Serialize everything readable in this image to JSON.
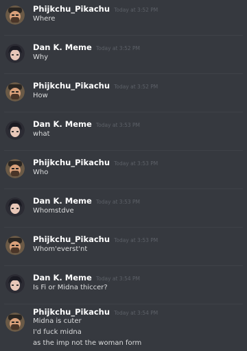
{
  "messages": [
    {
      "author": "Phijkchu_Pikachu",
      "timestamp": "Today at 3:52 PM",
      "lines": [
        "Where"
      ]
    },
    {
      "author": "Dan K. Meme",
      "timestamp": "Today at 3:52 PM",
      "lines": [
        "Why"
      ]
    },
    {
      "author": "Phijkchu_Pikachu",
      "timestamp": "Today at 3:52 PM",
      "lines": [
        "How"
      ]
    },
    {
      "author": "Dan K. Meme",
      "timestamp": "Today at 3:53 PM",
      "lines": [
        "what"
      ]
    },
    {
      "author": "Phijkchu_Pikachu",
      "timestamp": "Today at 3:53 PM",
      "lines": [
        "Who"
      ]
    },
    {
      "author": "Dan K. Meme",
      "timestamp": "Today at 3:53 PM",
      "lines": [
        "Whomstdve"
      ]
    },
    {
      "author": "Phijkchu_Pikachu",
      "timestamp": "Today at 3:53 PM",
      "lines": [
        "Whom'everst'nt"
      ]
    },
    {
      "author": "Dan K. Meme",
      "timestamp": "Today at 3:54 PM",
      "lines": [
        "Is Fi or Midna thiccer?"
      ]
    },
    {
      "author": "Phijkchu_Pikachu",
      "timestamp": "Today at 3:54 PM",
      "lines": [
        "Midna is cuter",
        "I'd fuck midna",
        "as the imp not the woman form"
      ]
    }
  ]
}
